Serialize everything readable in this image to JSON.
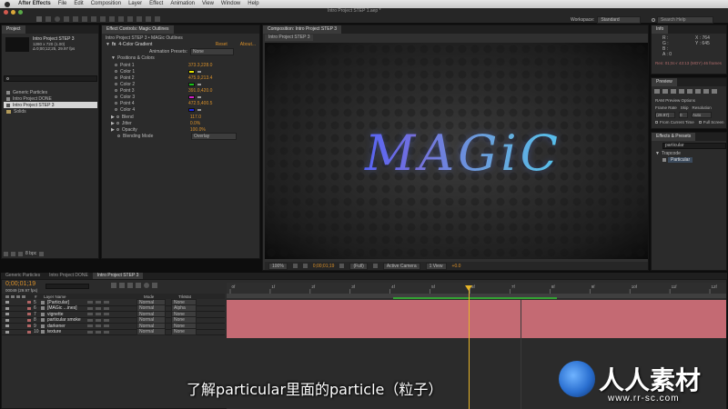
{
  "menubar": {
    "app_name": "After Effects",
    "items": [
      "File",
      "Edit",
      "Composition",
      "Layer",
      "Effect",
      "Animation",
      "View",
      "Window",
      "Help"
    ],
    "document_title": "Intro Project STEP 1.aep *"
  },
  "toolbar": {
    "workspace_label": "Workspace:",
    "workspace_value": "Standard",
    "search_placeholder": "Search Help"
  },
  "project_panel": {
    "tab": "Project",
    "comp_name": "Intro Project STEP 3",
    "comp_info_1": "1280 x 720 (1.00)",
    "comp_info_2": "Δ 0;00;12;25, 29.97 fps",
    "items": [
      {
        "name": "Generic Particles",
        "selected": false
      },
      {
        "name": "Intro Project DONE",
        "selected": false
      },
      {
        "name": "Intro Project STEP 3",
        "selected": true
      },
      {
        "name": "Solids",
        "selected": false
      }
    ],
    "bpc": "8 bpc"
  },
  "effect_controls": {
    "tab_1": "Effect Controls: Magic Outlines",
    "breadcrumb": "Intro Project STEP 3 • MAGic Outlines",
    "effect_name": "4-Color Gradient",
    "reset_label": "Reset",
    "about_label": "About...",
    "preset_label": "Animation Presets:",
    "preset_value": "None",
    "group_label": "Positions & Colors",
    "props": [
      {
        "name": "Point 1",
        "value": "373.3,228.0",
        "type": "point"
      },
      {
        "name": "Color 1",
        "color": "#e4e400",
        "type": "color"
      },
      {
        "name": "Point 2",
        "value": "475.9,213.4",
        "type": "point"
      },
      {
        "name": "Color 2",
        "color": "#19c319",
        "type": "color"
      },
      {
        "name": "Point 3",
        "value": "391.0,420.0",
        "type": "point"
      },
      {
        "name": "Color 3",
        "color": "#d21ec8",
        "type": "color"
      },
      {
        "name": "Point 4",
        "value": "472.5,400.5",
        "type": "point"
      },
      {
        "name": "Color 4",
        "color": "#1e28e6",
        "type": "color"
      }
    ],
    "blend_label": "Blend",
    "blend_value": "117.0",
    "jitter_label": "Jitter",
    "jitter_value": "0.0%",
    "opacity_label": "Opacity",
    "opacity_value": "100.0%",
    "blending_mode_label": "Blending Mode",
    "blending_mode_value": "Overlay"
  },
  "composition_panel": {
    "tab": "Composition: Intro Project STEP 3",
    "subtab": "Intro Project STEP 3",
    "magic_text": "MAGiC",
    "footer_zoom": "100%",
    "footer_time": "0;00;01;19",
    "footer_res": "(Full)",
    "footer_camera": "Active Camera",
    "footer_view": "1 View",
    "footer_exposure": "+0.0"
  },
  "info_panel": {
    "tab": "Info",
    "r_label": "R :",
    "g_label": "G :",
    "b_label": "B :",
    "a_label": "A : 0",
    "x_label": "X : 764",
    "y_label": "Y : 645",
    "status_line": "Ren: 01;0c-r 43:13 (MOY) 46 frames"
  },
  "preview_panel": {
    "tab": "Preview",
    "ram_options": "RAM Preview Options",
    "frame_rate_label": "Frame Rate",
    "skip_label": "Skip",
    "resolution_label": "Resolution",
    "frame_rate_value": "(29.97)",
    "skip_value": "0",
    "resolution_value": "Auto",
    "from_current": "From Current Time",
    "full_screen": "Full Screen"
  },
  "effects_presets_panel": {
    "tab": "Effects & Presets",
    "search_value": "particular",
    "category": "Trapcode",
    "item": "Particular"
  },
  "timeline_tabs": [
    "Generic Particles",
    "Intro Project DONE",
    "Intro Project STEP 3"
  ],
  "timeline": {
    "timecode": "0;00;01;19",
    "timecode_sub": "00049 (29.97 fps)",
    "col_num": "#",
    "col_name": "Layer Name",
    "col_mode": "Mode",
    "col_trkmat": "TrkMat",
    "ruler_labels": [
      "0f",
      "1f",
      "2f",
      "3f",
      "4f",
      "5f",
      "6f",
      "7f",
      "8f",
      "9f",
      "10f",
      "11f",
      "12f"
    ],
    "layers": [
      {
        "num": "5",
        "name": "[Particular]",
        "mode": "Normal",
        "trkmat": "None"
      },
      {
        "num": "6",
        "name": "[MAGic ...ines]",
        "mode": "Normal",
        "trkmat": "Alpha"
      },
      {
        "num": "7",
        "name": "vignette",
        "mode": "Normal",
        "trkmat": "None"
      },
      {
        "num": "8",
        "name": "particular smoke",
        "mode": "Normal",
        "trkmat": "None"
      },
      {
        "num": "9",
        "name": "darkener",
        "mode": "Normal",
        "trkmat": "None"
      },
      {
        "num": "10",
        "name": "texture",
        "mode": "Normal",
        "trkmat": "None"
      }
    ]
  },
  "subtitle": "了解particular里面的particle（粒子）",
  "watermark": {
    "brand": "人人素材",
    "url": "www.rr-sc.com"
  },
  "colors": {
    "accent_orange": "#d9902a",
    "layer_bar": "#c46a73",
    "playhead": "#e6b428"
  }
}
